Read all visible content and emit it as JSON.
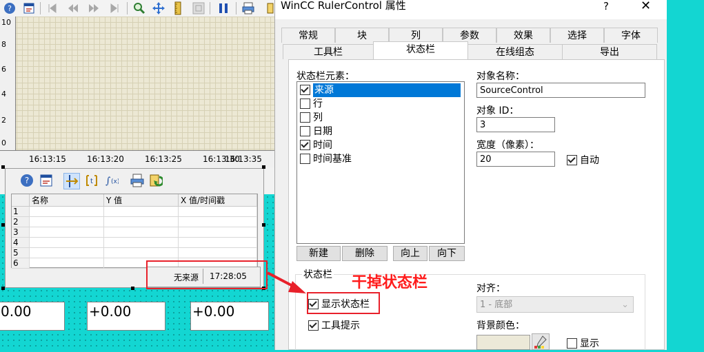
{
  "trend": {
    "y_ticks": [
      "10",
      "8",
      "6",
      "4",
      "2",
      "0"
    ],
    "x_ticks": [
      "16:13:15",
      "16:13:20",
      "16:13:25",
      "16:13:30",
      "16:13:35"
    ]
  },
  "ruler": {
    "columns": [
      "名称",
      "Y 值",
      "X 值/时间戳"
    ],
    "rows": [
      "1",
      "2",
      "3",
      "4",
      "5",
      "6"
    ],
    "status_source": "无来源",
    "status_time": "17:28:05"
  },
  "value_boxes": [
    "0.00",
    "+0.00",
    "+0.00"
  ],
  "annotation": "干掉状态栏",
  "dialog": {
    "title": "WinCC RulerControl 属性",
    "help": "?",
    "close": "✕",
    "tabs_row1": [
      "常规",
      "块",
      "列",
      "参数",
      "效果",
      "选择",
      "字体"
    ],
    "tabs_row2": [
      "工具栏",
      "状态栏",
      "在线组态",
      "导出"
    ],
    "elements_label": "状态栏元素：",
    "elements": [
      {
        "label": "来源",
        "checked": true,
        "selected": true
      },
      {
        "label": "行",
        "checked": false,
        "selected": false
      },
      {
        "label": "列",
        "checked": false,
        "selected": false
      },
      {
        "label": "日期",
        "checked": false,
        "selected": false
      },
      {
        "label": "时间",
        "checked": true,
        "selected": false
      },
      {
        "label": "时间基准",
        "checked": false,
        "selected": false
      }
    ],
    "object_name_label": "对象名称：",
    "object_name_value": "SourceControl",
    "object_id_label": "对象 ID：",
    "object_id_value": "3",
    "width_label": "宽度（像素）：",
    "width_value": "20",
    "auto_label": "自动",
    "buttons": [
      "新建",
      "删除",
      "向上",
      "向下"
    ],
    "statusbar_group_label": "状态栏",
    "show_statusbar_label": "显示状态栏",
    "tooltip_label": "工具提示",
    "align_label": "对齐：",
    "align_value": "1 - 底部",
    "bg_color_label": "背景颜色：",
    "show_label": "显示"
  }
}
